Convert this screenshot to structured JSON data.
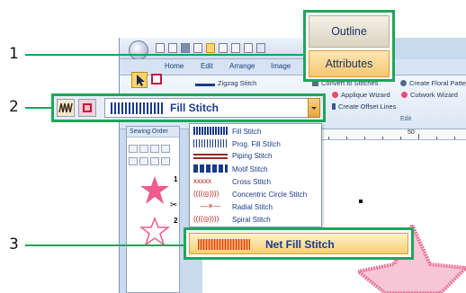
{
  "callouts": {
    "one": "1",
    "two": "2",
    "three": "3"
  },
  "ribbon": {
    "tabs": [
      "Home",
      "Edit",
      "Arrange",
      "Image"
    ],
    "commands": {
      "zigzag": "Zigzag Stitch",
      "convert": "Convert to Stitches",
      "create_floral": "Create Floral Patte",
      "applique": "Applique Wizard",
      "cutwork": "Cutwork Wizard",
      "offset": "Create Offset Lines"
    },
    "group_label": "Edit"
  },
  "ruler": {
    "label": "50"
  },
  "attribute_tabs": {
    "outline": "Outline",
    "attributes": "Attributes"
  },
  "fill_bar": {
    "selected": "Fill Stitch"
  },
  "sewing_order": {
    "title": "Sewing Order",
    "items": [
      "1",
      "2"
    ]
  },
  "stitch_list": [
    "Fill Stitch",
    "Prog. Fill Stitch",
    "Piping Stitch",
    "Motif Stitch",
    "Cross Stitch",
    "Concentric Circle Stitch",
    "Radial Stitch",
    "Spiral Stitch"
  ],
  "net_fill": {
    "label": "Net Fill Stitch"
  },
  "colors": {
    "callout_border": "#1fa65b",
    "list_text": "#1a3a8c",
    "star_pink": "#ef5b8f",
    "attributes_orange": "#f7c771"
  }
}
